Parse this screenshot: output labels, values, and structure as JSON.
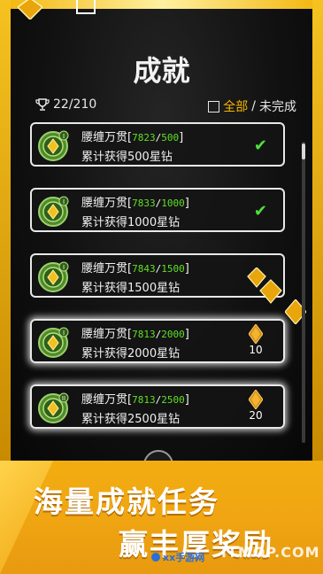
{
  "header": {
    "title": "成就"
  },
  "stats": {
    "trophy_count": "22/210"
  },
  "filter": {
    "all_label": "全部",
    "separator": "/",
    "incomplete_label": "未完成"
  },
  "achievements": [
    {
      "name": "腰缠万贯",
      "prefix": "[",
      "current": "7823",
      "slash": "/",
      "target": "500",
      "suffix": "]",
      "desc": "累计获得500星钻",
      "status": "completed"
    },
    {
      "name": "腰缠万贯",
      "prefix": "[",
      "current": "7833",
      "slash": "/",
      "target": "1000",
      "suffix": "]",
      "desc": "累计获得1000星钻",
      "status": "completed"
    },
    {
      "name": "腰缠万贯",
      "prefix": "[",
      "current": "7843",
      "slash": "/",
      "target": "1500",
      "suffix": "]",
      "desc": "累计获得1500星钻",
      "status": "claimable"
    },
    {
      "name": "腰缠万贯",
      "prefix": "[",
      "current": "7813",
      "slash": "/",
      "target": "2000",
      "suffix": "]",
      "desc": "累计获得2000星钻",
      "status": "reward",
      "reward": "10"
    },
    {
      "name": "腰缠万贯",
      "prefix": "[",
      "current": "7813",
      "slash": "/",
      "target": "2500",
      "suffix": "]",
      "desc": "累计获得2500星钻",
      "status": "reward",
      "reward": "20"
    }
  ],
  "banner": {
    "line1": "海量成就任务",
    "line2": "赢丰厚奖励"
  },
  "watermark": {
    "site1": "xx手游网",
    "site2": "ITMOP.COM"
  },
  "colors": {
    "accent": "#f5b400",
    "progress": "#5fe025",
    "check": "#4ee33a",
    "banner": "#f0a512"
  }
}
